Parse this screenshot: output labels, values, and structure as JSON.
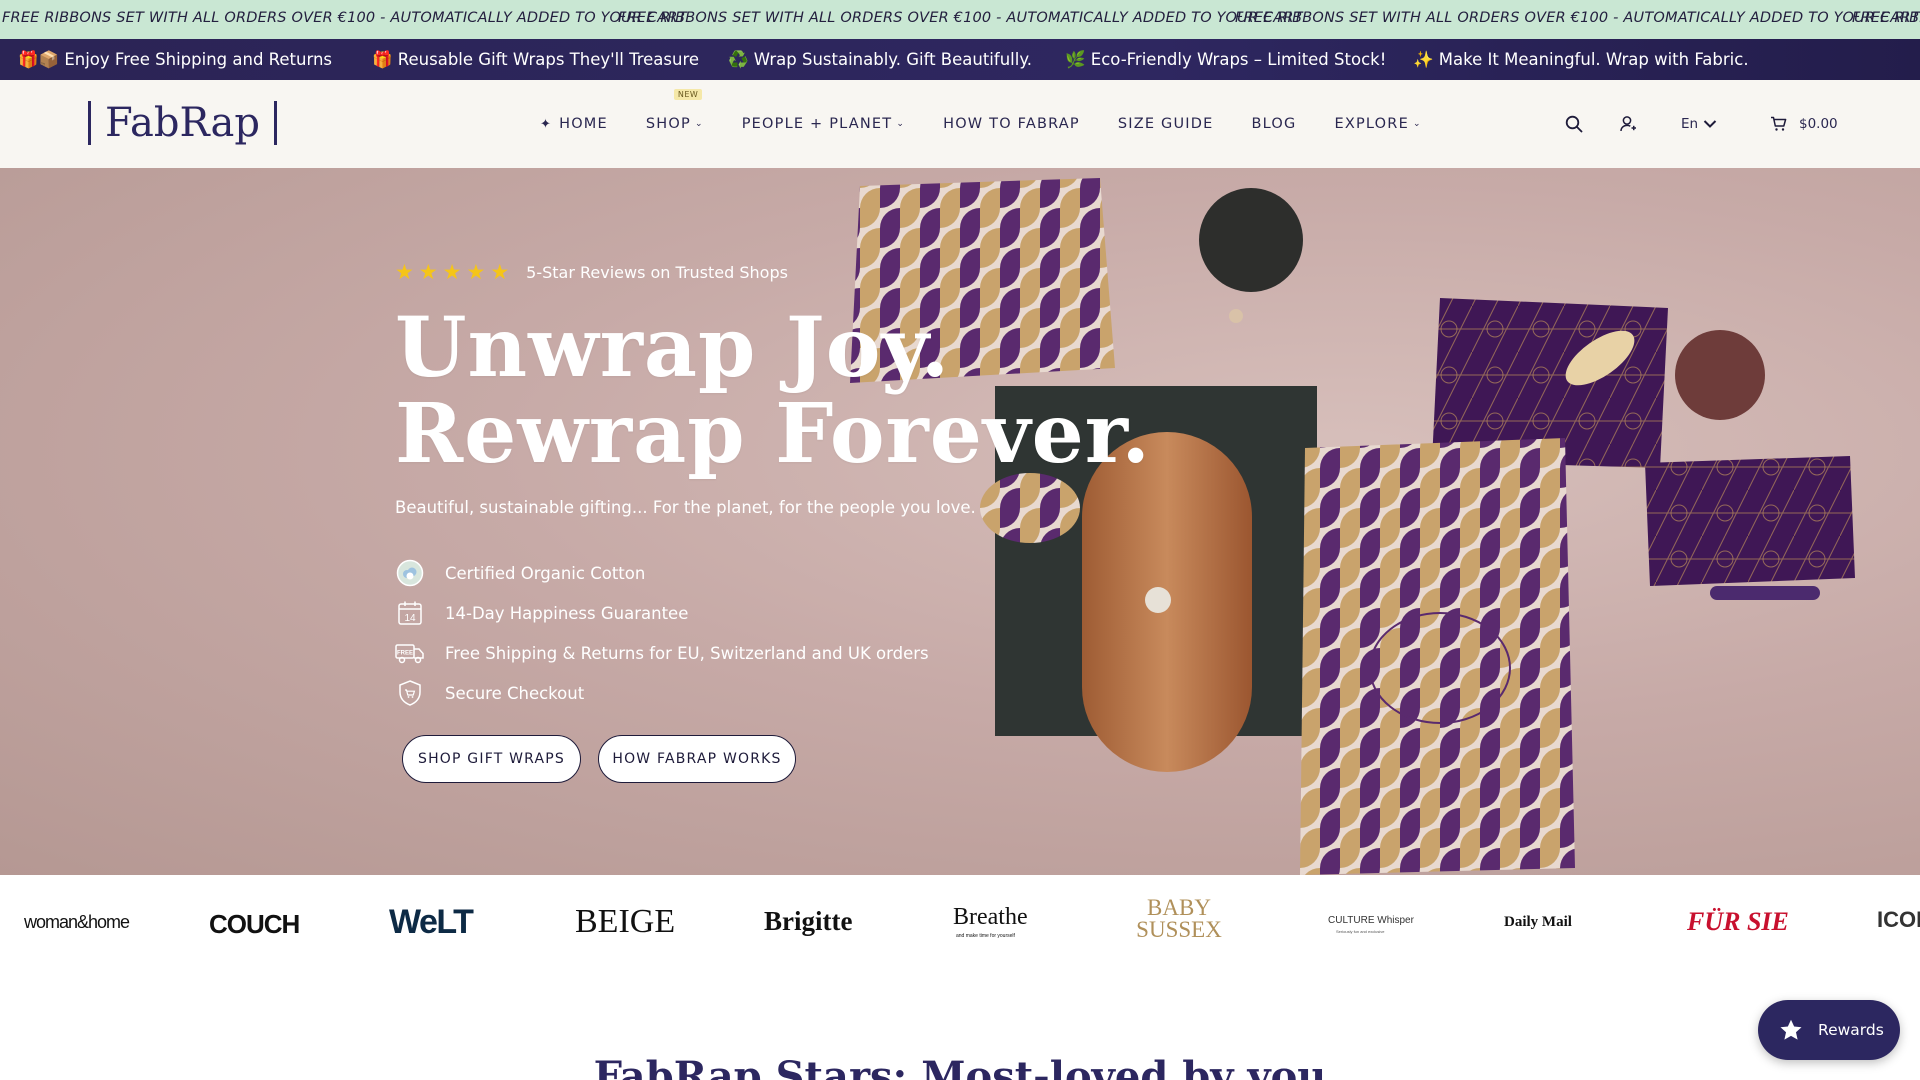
{
  "ticker": {
    "items": [
      "FREE RIBBONS SET WITH ALL ORDERS OVER €100 - AUTOMATICALLY ADDED TO YOUR CART",
      "FREE RIBBONS SET WITH ALL ORDERS OVER €100 - AUTOMATICALLY ADDED TO YOUR CART",
      "FREE RIBBONS SET WITH ALL ORDERS OVER €100 - AUTOMATICALLY ADDED TO YOUR CART",
      "FREE RIBB"
    ]
  },
  "announcements": [
    "🎁📦 Enjoy Free Shipping and Returns",
    "🎁 Reusable Gift Wraps They'll Treasure",
    "♻️ Wrap Sustainably. Gift Beautifully.",
    "🌿 Eco-Friendly Wraps – Limited Stock!",
    "✨ Make It Meaningful. Wrap with Fabric."
  ],
  "header": {
    "logo": "FabRap",
    "nav": [
      {
        "label": "HOME",
        "icon": "sparkle-icon"
      },
      {
        "label": "SHOP",
        "badge": "NEW",
        "dropdown": true
      },
      {
        "label": "PEOPLE + PLANET",
        "dropdown": true
      },
      {
        "label": "HOW TO FABRAP"
      },
      {
        "label": "SIZE GUIDE"
      },
      {
        "label": "BLOG"
      },
      {
        "label": "EXPLORE",
        "dropdown": true
      }
    ],
    "lang": "En",
    "cart_total": "$0.00"
  },
  "hero": {
    "rating_text": "5-Star Reviews on Trusted Shops",
    "title_line1": "Unwrap Joy.",
    "title_line2": "Rewrap Forever.",
    "subtitle": "Beautiful, sustainable gifting... For the planet, for the people you love.",
    "features": [
      {
        "icon": "organic-cotton-icon",
        "text": "Certified Organic Cotton"
      },
      {
        "icon": "calendar-14-icon",
        "text": "14-Day Happiness Guarantee"
      },
      {
        "icon": "free-shipping-truck-icon",
        "text": "Free Shipping & Returns for EU, Switzerland and UK orders"
      },
      {
        "icon": "secure-cart-icon",
        "text": "Secure Checkout"
      }
    ],
    "calendar_number": "14",
    "truck_label": "FREE",
    "btn_primary": "SHOP GIFT WRAPS",
    "btn_secondary": "HOW FABRAP WORKS"
  },
  "press": [
    "woman&home",
    "COUCH",
    "WeLT",
    "BEIGE",
    "Brigitte",
    "Breathe",
    "BABY SUSSEX",
    "CULTURE Whisper",
    "Daily Mail",
    "FÜR SIE",
    "ICON"
  ],
  "press_extra": {
    "breathe_tagline": "and make time for yourself",
    "culture_tagline": "Seriously fun and exclusive"
  },
  "section": {
    "title": "FabRap Stars: Most-loved by you"
  },
  "rewards": {
    "label": "Rewards"
  },
  "colors": {
    "brand": "#2c2760",
    "ticker_bg": "#c9e7d3",
    "star": "#f5c518",
    "header_bg": "#f8f6f2"
  }
}
